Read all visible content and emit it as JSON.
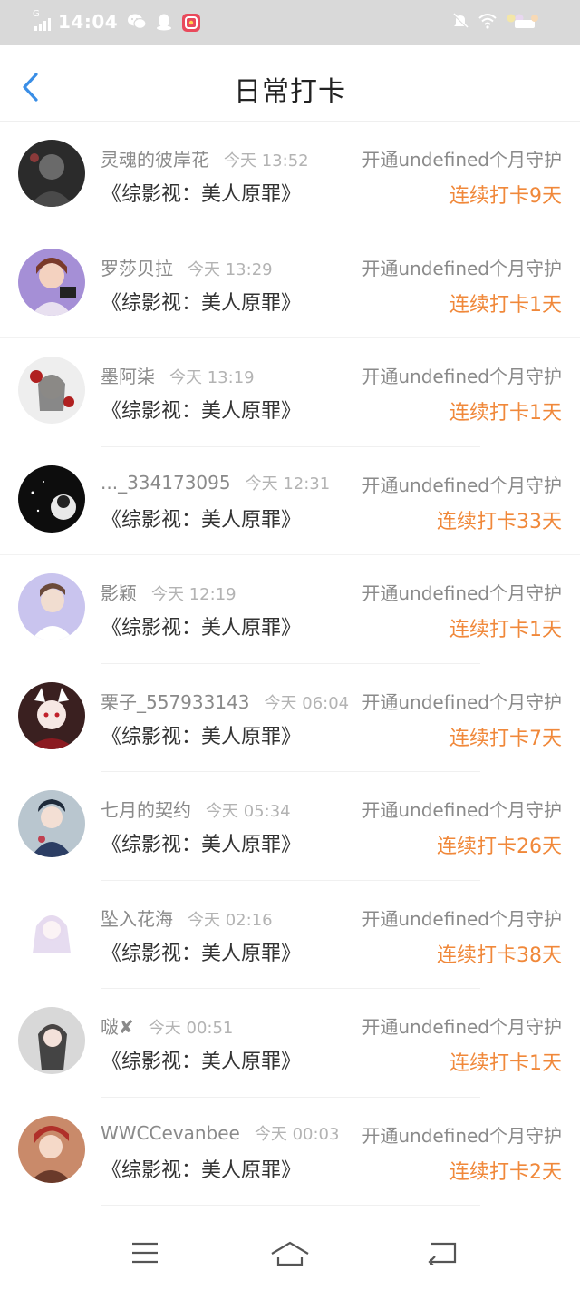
{
  "status_bar": {
    "network": "G",
    "time": "14:04",
    "icons": [
      "signal-icon",
      "wechat-icon",
      "qq-icon",
      "app-icon",
      "mute-icon",
      "wifi-icon",
      "battery-icon"
    ]
  },
  "header": {
    "title": "日常打卡",
    "back_icon": "chevron-left-icon"
  },
  "colors": {
    "accent": "#3a8ee6",
    "streak": "#f0883a",
    "status_bar": "#d9d9d9"
  },
  "checkins": [
    {
      "name": "灵魂的彼岸花",
      "time": "今天 13:52",
      "book": "《综影视：美人原罪》",
      "guard": "开通undefined个月守护",
      "streak": "连续打卡9天"
    },
    {
      "name": "罗莎贝拉",
      "time": "今天 13:29",
      "book": "《综影视：美人原罪》",
      "guard": "开通undefined个月守护",
      "streak": "连续打卡1天"
    },
    {
      "name": "墨阿柒",
      "time": "今天 13:19",
      "book": "《综影视：美人原罪》",
      "guard": "开通undefined个月守护",
      "streak": "连续打卡1天"
    },
    {
      "name": "..._334173095",
      "time": "今天 12:31",
      "book": "《综影视：美人原罪》",
      "guard": "开通undefined个月守护",
      "streak": "连续打卡33天"
    },
    {
      "name": "影颖",
      "time": "今天 12:19",
      "book": "《综影视：美人原罪》",
      "guard": "开通undefined个月守护",
      "streak": "连续打卡1天"
    },
    {
      "name": "栗子_557933143",
      "time": "今天 06:04",
      "book": "《综影视：美人原罪》",
      "guard": "开通undefined个月守护",
      "streak": "连续打卡7天"
    },
    {
      "name": "七月的契约",
      "time": "今天 05:34",
      "book": "《综影视：美人原罪》",
      "guard": "开通undefined个月守护",
      "streak": "连续打卡26天"
    },
    {
      "name": "坠入花海",
      "time": "今天 02:16",
      "book": "《综影视：美人原罪》",
      "guard": "开通undefined个月守护",
      "streak": "连续打卡38天"
    },
    {
      "name": "啵✘",
      "time": "今天 00:51",
      "book": "《综影视：美人原罪》",
      "guard": "开通undefined个月守护",
      "streak": "连续打卡1天"
    },
    {
      "name": "WWCCevanbee",
      "time": "今天 00:03",
      "book": "《综影视：美人原罪》",
      "guard": "开通undefined个月守护",
      "streak": "连续打卡2天"
    }
  ],
  "nav_bar": {
    "icons": [
      "menu-icon",
      "home-icon",
      "back-icon"
    ]
  }
}
